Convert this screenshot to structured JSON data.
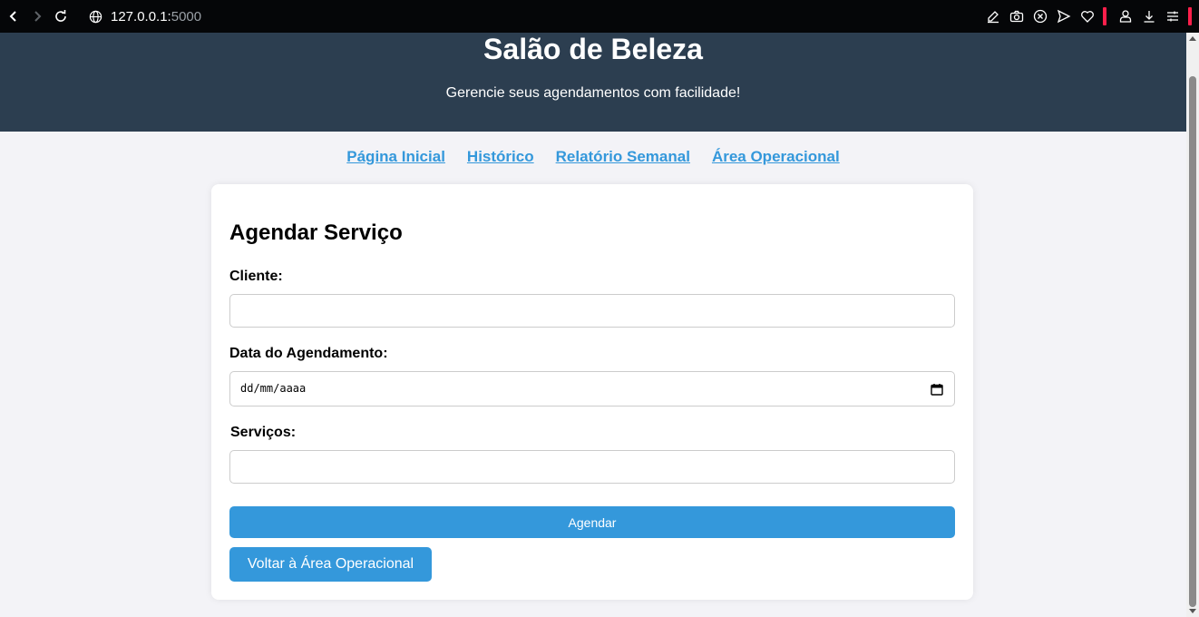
{
  "browser": {
    "url_host": "127.0.0.1:",
    "url_port": "5000",
    "accent_color": "#ff1f4b"
  },
  "header": {
    "title": "Salão de Beleza",
    "subtitle": "Gerencie seus agendamentos com facilidade!",
    "background_color": "#2c3e50"
  },
  "nav": {
    "links": [
      "Página Inicial",
      "Histórico",
      "Relatório Semanal",
      "Área Operacional"
    ],
    "color": "#3498db"
  },
  "form": {
    "title": "Agendar Serviço",
    "client_label": "Cliente:",
    "client_value": "",
    "date_label": "Data do Agendamento:",
    "date_placeholder": "dd/mm/aaaa",
    "services_label": "Serviços:",
    "services_value": "",
    "submit_label": "Agendar",
    "back_label": "Voltar à Área Operacional",
    "button_color": "#3498db"
  }
}
